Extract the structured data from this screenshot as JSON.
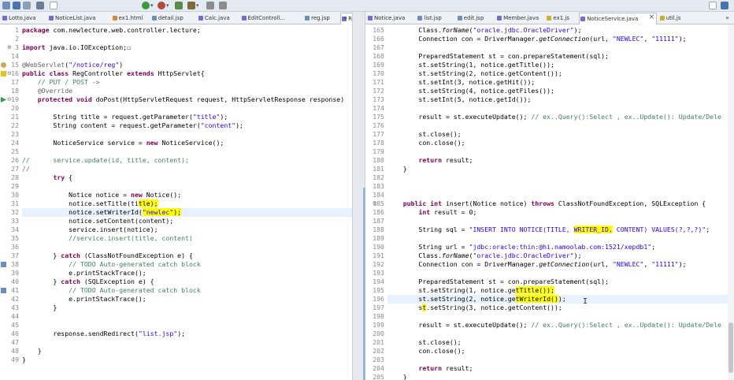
{
  "toolbar": {
    "icons": [
      "new-icon",
      "save-icon",
      "print-icon",
      "debug-icon",
      "run-icon",
      "external-tools-icon",
      "new-java-class-icon",
      "open-type-icon",
      "search-icon",
      "back-icon",
      "forward-icon"
    ],
    "right_icons": [
      "quick-access-icon",
      "perspective-icon"
    ]
  },
  "left_editor": {
    "tabs": [
      {
        "label": "Lotto.java",
        "kind": "java"
      },
      {
        "label": "NoticeList.java",
        "kind": "java"
      },
      {
        "label": "ex1.html",
        "kind": "html"
      },
      {
        "label": "detail.jsp",
        "kind": "jsp"
      },
      {
        "label": "Calc.java",
        "kind": "java"
      },
      {
        "label": "EditControll...",
        "kind": "java"
      },
      {
        "label": "reg.jsp",
        "kind": "jsp"
      },
      {
        "label": "RegControll...",
        "kind": "java",
        "active": true
      }
    ],
    "overflow_label": "»",
    "lines": [
      {
        "n": "1",
        "t": "package com.newlecture.web.controller.lecture;"
      },
      {
        "n": "2",
        "t": ""
      },
      {
        "n": "3",
        "t": "import java.io.IOException;☐",
        "fold": true
      },
      {
        "n": "14",
        "t": ""
      },
      {
        "n": "15",
        "t": "@WebServlet(\"/notice/reg\")"
      },
      {
        "n": "16",
        "t": "public class RegController extends HttpServlet{"
      },
      {
        "n": "17",
        "t": "    // PUT / POST ->"
      },
      {
        "n": "18",
        "t": "    @Override"
      },
      {
        "n": "19",
        "t": "    protected void doPost(HttpServletRequest request, HttpServletResponse response)"
      },
      {
        "n": "20",
        "t": ""
      },
      {
        "n": "21",
        "t": "        String title = request.getParameter(\"title\");"
      },
      {
        "n": "22",
        "t": "        String content = request.getParameter(\"content\");"
      },
      {
        "n": "23",
        "t": ""
      },
      {
        "n": "24",
        "t": "        NoticeService service = new NoticeService();"
      },
      {
        "n": "25",
        "t": ""
      },
      {
        "n": "26",
        "t": "//      service.update(id, title, content);"
      },
      {
        "n": "27",
        "t": "//"
      },
      {
        "n": "28",
        "t": "        try {"
      },
      {
        "n": "29",
        "t": ""
      },
      {
        "n": "30",
        "t": "            Notice notice = new Notice();"
      },
      {
        "n": "31",
        "t": "            notice.setTitle(title);"
      },
      {
        "n": "32",
        "t": "            notice.setWriterId(\"newlec\");"
      },
      {
        "n": "33",
        "t": "            notice.setContent(content);"
      },
      {
        "n": "34",
        "t": "            service.insert(notice);"
      },
      {
        "n": "35",
        "t": "            //service.insert(title, content)"
      },
      {
        "n": "36",
        "t": ""
      },
      {
        "n": "37",
        "t": "        } catch (ClassNotFoundException e) {"
      },
      {
        "n": "38",
        "t": "            // TODO Auto-generated catch block"
      },
      {
        "n": "39",
        "t": "            e.printStackTrace();"
      },
      {
        "n": "40",
        "t": "        } catch (SQLException e) {"
      },
      {
        "n": "41",
        "t": "            // TODO Auto-generated catch block"
      },
      {
        "n": "42",
        "t": "            e.printStackTrace();"
      },
      {
        "n": "43",
        "t": "        }"
      },
      {
        "n": "44",
        "t": ""
      },
      {
        "n": "45",
        "t": ""
      },
      {
        "n": "46",
        "t": "        response.sendRedirect(\"list.jsp\");"
      },
      {
        "n": "47",
        "t": ""
      },
      {
        "n": "48",
        "t": "    }"
      },
      {
        "n": "49",
        "t": "}"
      }
    ]
  },
  "right_editor": {
    "tabs": [
      {
        "label": "Notice.java",
        "kind": "java"
      },
      {
        "label": "list.jsp",
        "kind": "jsp"
      },
      {
        "label": "edit.jsp",
        "kind": "jsp"
      },
      {
        "label": "Member.java",
        "kind": "java"
      },
      {
        "label": "ex1.js",
        "kind": "js"
      },
      {
        "label": "NoticeService.java",
        "kind": "java",
        "active": true
      },
      {
        "label": "util.js",
        "kind": "js"
      }
    ],
    "overflow_label": "»",
    "lines": [
      {
        "n": "165",
        "t": "        Class.forName(\"oracle.jdbc.OracleDriver\");"
      },
      {
        "n": "166",
        "t": "        Connection con = DriverManager.getConnection(url, \"NEWLEC\", \"11111\");"
      },
      {
        "n": "167",
        "t": ""
      },
      {
        "n": "168",
        "t": "        PreparedStatement st = con.prepareStatement(sql);"
      },
      {
        "n": "169",
        "t": "        st.setString(1, notice.getTitle());"
      },
      {
        "n": "170",
        "t": "        st.setString(2, notice.getContent());"
      },
      {
        "n": "171",
        "t": "        st.setInt(3, notice.getHit());"
      },
      {
        "n": "172",
        "t": "        st.setString(4, notice.getFiles());"
      },
      {
        "n": "173",
        "t": "        st.setInt(5, notice.getId());"
      },
      {
        "n": "174",
        "t": ""
      },
      {
        "n": "175",
        "t": "        result = st.executeUpdate(); // ex..Query():Select , ex..Update(): Update/Dele"
      },
      {
        "n": "176",
        "t": ""
      },
      {
        "n": "177",
        "t": "        st.close();"
      },
      {
        "n": "178",
        "t": "        con.close();"
      },
      {
        "n": "179",
        "t": ""
      },
      {
        "n": "180",
        "t": "        return result;"
      },
      {
        "n": "181",
        "t": "    }"
      },
      {
        "n": "182",
        "t": ""
      },
      {
        "n": "183",
        "t": ""
      },
      {
        "n": "184",
        "t": ""
      },
      {
        "n": "185",
        "t": "    public int insert(Notice notice) throws ClassNotFoundException, SQLException {"
      },
      {
        "n": "186",
        "t": "        int result = 0;"
      },
      {
        "n": "187",
        "t": ""
      },
      {
        "n": "188",
        "t": "        String sql = \"INSERT INTO NOTICE(TITLE, WRITER_ID, CONTENT) VALUES(?,?,?)\";"
      },
      {
        "n": "189",
        "t": ""
      },
      {
        "n": "190",
        "t": "        String url = \"jdbc:oracle:thin:@hi.namoolab.com:1521/xepdb1\";"
      },
      {
        "n": "191",
        "t": "        Class.forName(\"oracle.jdbc.OracleDriver\");"
      },
      {
        "n": "192",
        "t": "        Connection con = DriverManager.getConnection(url, \"NEWLEC\", \"11111\");"
      },
      {
        "n": "193",
        "t": ""
      },
      {
        "n": "194",
        "t": "        PreparedStatement st = con.prepareStatement(sql);"
      },
      {
        "n": "195",
        "t": "        st.setString(1, notice.getTitle());"
      },
      {
        "n": "196",
        "t": "        st.setString(2, notice.getWriterId());"
      },
      {
        "n": "197",
        "t": "        st.setString(3, notice.getContent());"
      },
      {
        "n": "198",
        "t": ""
      },
      {
        "n": "199",
        "t": "        result = st.executeUpdate(); // ex..Query():Select , ex..Update(): Update/Dele"
      },
      {
        "n": "200",
        "t": ""
      },
      {
        "n": "201",
        "t": "        st.close();"
      },
      {
        "n": "202",
        "t": "        con.close();"
      },
      {
        "n": "203",
        "t": ""
      },
      {
        "n": "204",
        "t": "        return result;"
      },
      {
        "n": "205",
        "t": "    }"
      }
    ]
  },
  "colors": {
    "keyword": "#7f0055",
    "string": "#2a00ff",
    "comment": "#3f7f5f",
    "highlight": "#ffff00",
    "current_line": "#e8f2fe"
  }
}
